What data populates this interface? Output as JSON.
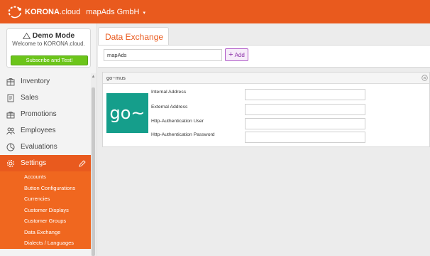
{
  "topbar": {
    "brand": "KORONA",
    "brand_suffix": ".cloud",
    "tenant": "mapAds GmbH",
    "tenant_caret": "▾",
    "color": "#e95a1e"
  },
  "demo": {
    "title": "Demo Mode",
    "subtitle": "Welcome to KORONA.cloud.",
    "button": "Subscribe and Test!"
  },
  "nav": {
    "items": [
      {
        "label": "Inventory",
        "icon": "inventory-icon"
      },
      {
        "label": "Sales",
        "icon": "sales-icon"
      },
      {
        "label": "Promotions",
        "icon": "promotions-icon"
      },
      {
        "label": "Employees",
        "icon": "employees-icon"
      },
      {
        "label": "Evaluations",
        "icon": "evaluations-icon"
      },
      {
        "label": "Settings",
        "icon": "settings-icon",
        "active": true
      }
    ],
    "settings_sub": [
      "Accounts",
      "Button Configurations",
      "Currencies",
      "Customer Displays",
      "Customer Groups",
      "Data Exchange",
      "Dialects / Languages"
    ]
  },
  "main": {
    "tab": "Data Exchange",
    "search_value": "mapAds",
    "add_label": "Add",
    "add_plus": "+",
    "panel": {
      "title": "go~mus",
      "logo_text": "go~",
      "fields": [
        {
          "label": "Internal Address",
          "value": ""
        },
        {
          "label": "External Address",
          "value": ""
        },
        {
          "label": "Http-Authentication User",
          "value": ""
        },
        {
          "label": "Http-Authentication Password",
          "value": ""
        }
      ]
    }
  }
}
